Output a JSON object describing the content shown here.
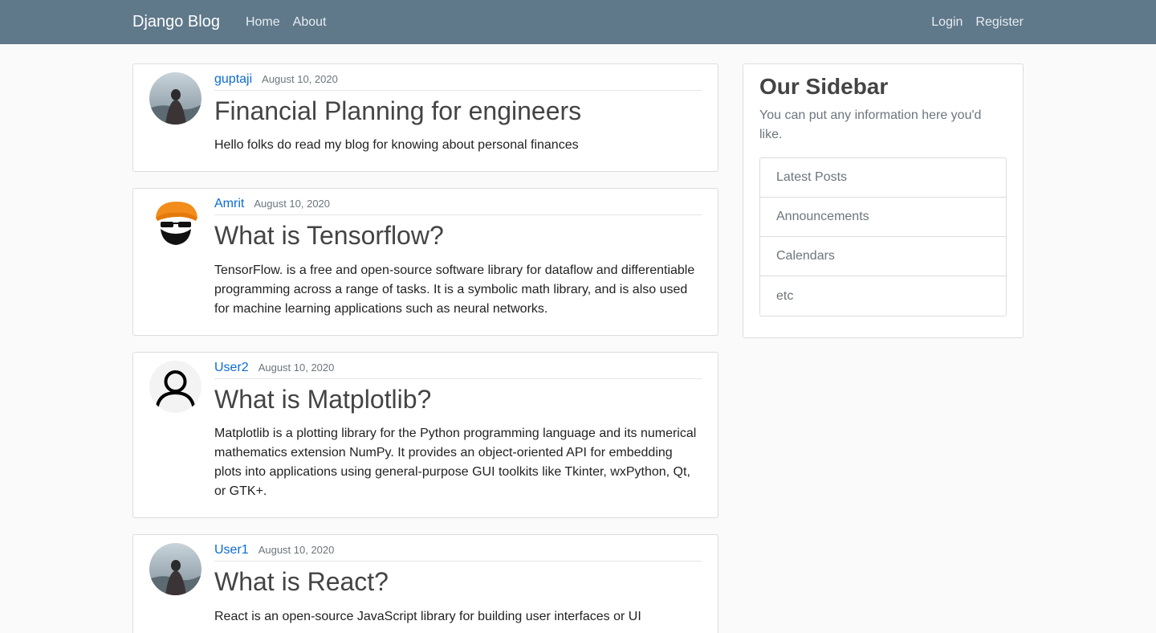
{
  "navbar": {
    "brand": "Django Blog",
    "links": [
      "Home",
      "About"
    ],
    "right_links": [
      "Login",
      "Register"
    ]
  },
  "posts": [
    {
      "author": "guptaji",
      "date": "August 10, 2020",
      "title": "Financial Planning for engineers",
      "content": "Hello folks do read my blog for knowing about personal finances",
      "avatar": "landscape-avatar"
    },
    {
      "author": "Amrit",
      "date": "August 10, 2020",
      "title": "What is Tensorflow?",
      "content": "TensorFlow. is a free and open-source software library for dataflow and differentiable programming across a range of tasks. It is a symbolic math library, and is also used for machine learning applications such as neural networks.",
      "avatar": "turban-avatar"
    },
    {
      "author": "User2",
      "date": "August 10, 2020",
      "title": "What is Matplotlib?",
      "content": "Matplotlib is a plotting library for the Python programming language and its numerical mathematics extension NumPy. It provides an object-oriented API for embedding plots into applications using general-purpose GUI toolkits like Tkinter, wxPython, Qt, or GTK+.",
      "avatar": "user-outline-avatar"
    },
    {
      "author": "User1",
      "date": "August 10, 2020",
      "title": "What is React?",
      "content": "React is an open-source JavaScript library for building user interfaces or UI",
      "avatar": "landscape-avatar"
    }
  ],
  "sidebar": {
    "title": "Our Sidebar",
    "text": "You can put any information here you'd like.",
    "items": [
      "Latest Posts",
      "Announcements",
      "Calendars",
      "etc"
    ]
  },
  "colors": {
    "navbar": "#5f788a",
    "link": "#0b6bd4"
  }
}
